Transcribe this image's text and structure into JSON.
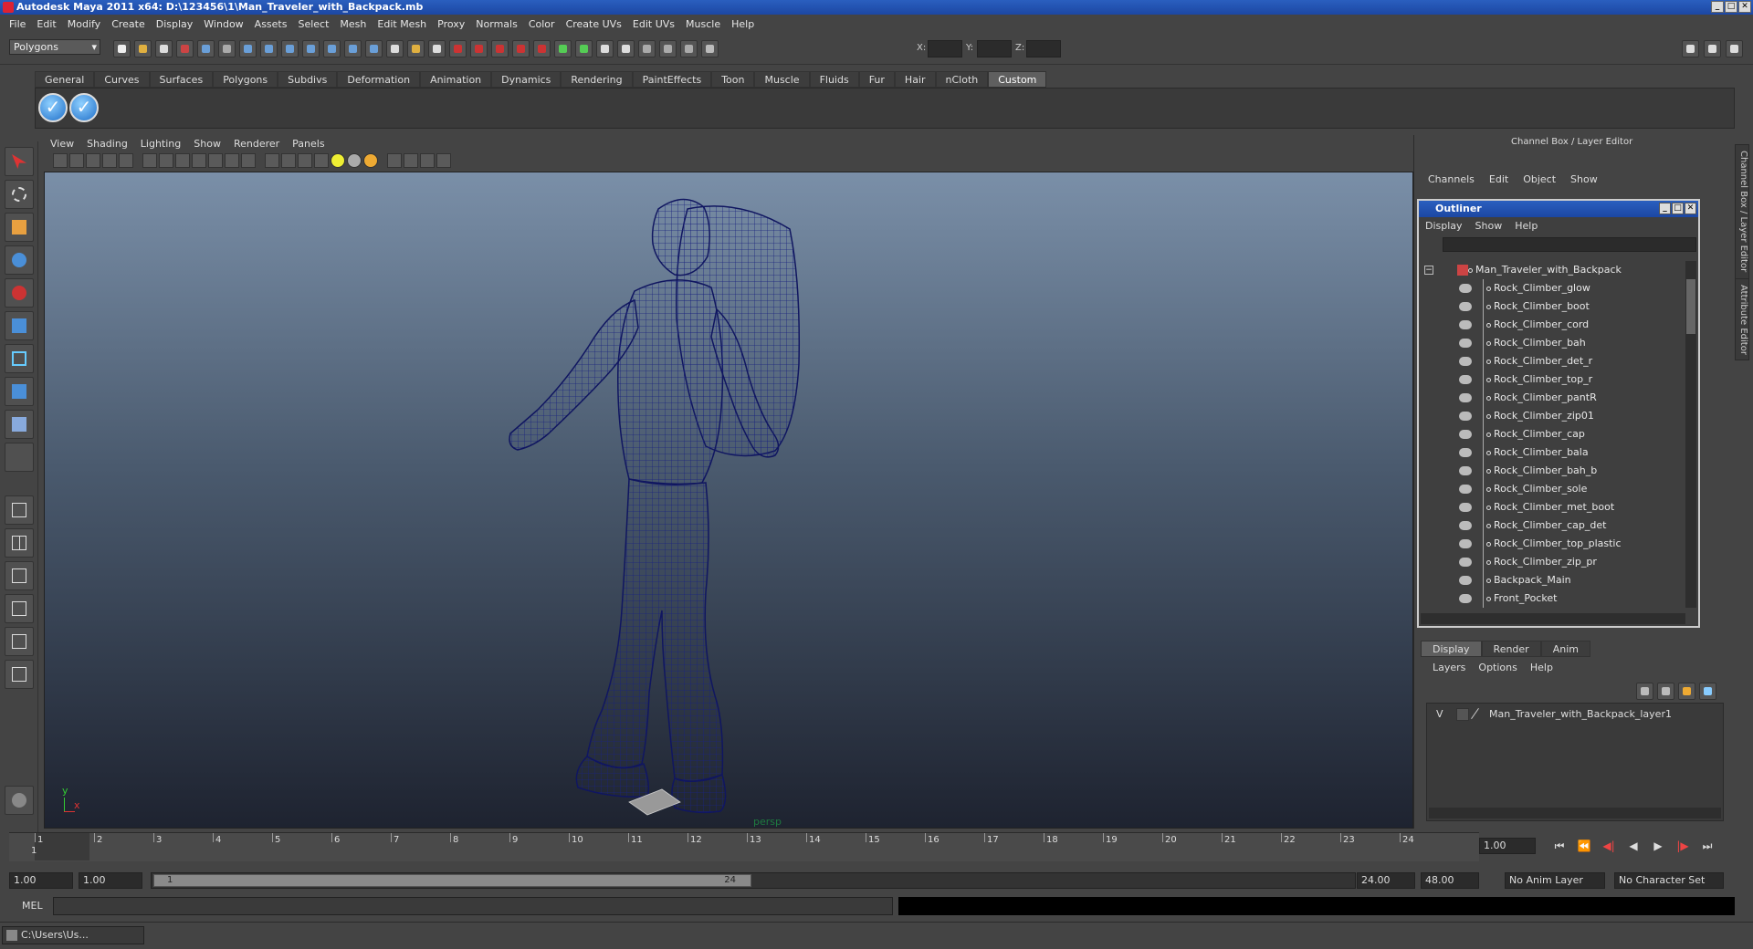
{
  "window": {
    "title": "Autodesk Maya 2011 x64: D:\\123456\\1\\Man_Traveler_with_Backpack.mb"
  },
  "menubar": [
    "File",
    "Edit",
    "Modify",
    "Create",
    "Display",
    "Window",
    "Assets",
    "Select",
    "Mesh",
    "Edit Mesh",
    "Proxy",
    "Normals",
    "Color",
    "Create UVs",
    "Edit UVs",
    "Muscle",
    "Help"
  ],
  "status_line": {
    "mode": "Polygons",
    "x_label": "X:",
    "y_label": "Y:",
    "z_label": "Z:"
  },
  "shelf": {
    "tabs": [
      "General",
      "Curves",
      "Surfaces",
      "Polygons",
      "Subdivs",
      "Deformation",
      "Animation",
      "Dynamics",
      "Rendering",
      "PaintEffects",
      "Toon",
      "Muscle",
      "Fluids",
      "Fur",
      "Hair",
      "nCloth",
      "Custom"
    ],
    "active_tab": "Custom"
  },
  "viewport": {
    "menu": [
      "View",
      "Shading",
      "Lighting",
      "Show",
      "Renderer",
      "Panels"
    ],
    "camera_label": "persp",
    "axis_y": "y",
    "axis_x": "x",
    "wire_color": "#1a237e"
  },
  "channel_box": {
    "title": "Channel Box / Layer Editor",
    "menu": [
      "Channels",
      "Edit",
      "Object",
      "Show"
    ]
  },
  "outliner": {
    "title": "Outliner",
    "menu": [
      "Display",
      "Show",
      "Help"
    ],
    "root": "Man_Traveler_with_Backpack",
    "items": [
      "Rock_Climber_glow",
      "Rock_Climber_boot",
      "Rock_Climber_cord",
      "Rock_Climber_bah",
      "Rock_Climber_det_r",
      "Rock_Climber_top_r",
      "Rock_Climber_pantR",
      "Rock_Climber_zip01",
      "Rock_Climber_cap",
      "Rock_Climber_bala",
      "Rock_Climber_bah_b",
      "Rock_Climber_sole",
      "Rock_Climber_met_boot",
      "Rock_Climber_cap_det",
      "Rock_Climber_top_plastic",
      "Rock_Climber_zip_pr",
      "Backpack_Main",
      "Front_Pocket"
    ]
  },
  "layer_editor": {
    "tabs": [
      "Display",
      "Render",
      "Anim"
    ],
    "active_tab": "Display",
    "menu": [
      "Layers",
      "Options",
      "Help"
    ],
    "layer": {
      "visible": "V",
      "name": "Man_Traveler_with_Backpack_layer1"
    }
  },
  "side_tabs": {
    "channel_box": "Channel Box / Layer Editor",
    "attribute_editor": "Attribute Editor"
  },
  "timeline": {
    "ticks": [
      "1",
      "2",
      "3",
      "4",
      "5",
      "6",
      "7",
      "8",
      "9",
      "10",
      "11",
      "12",
      "13",
      "14",
      "15",
      "16",
      "17",
      "18",
      "19",
      "20",
      "21",
      "22",
      "23",
      "24"
    ],
    "current_frame": "1.00",
    "current_marker": "1"
  },
  "range": {
    "start": "1.00",
    "playback_start": "1.00",
    "slider_start": "1",
    "slider_end": "24",
    "playback_end": "24.00",
    "end": "48.00",
    "anim_layer": "No Anim Layer",
    "character_set": "No Character Set"
  },
  "command_line": {
    "label": "MEL"
  },
  "taskbar": {
    "window": "C:\\Users\\Us..."
  }
}
